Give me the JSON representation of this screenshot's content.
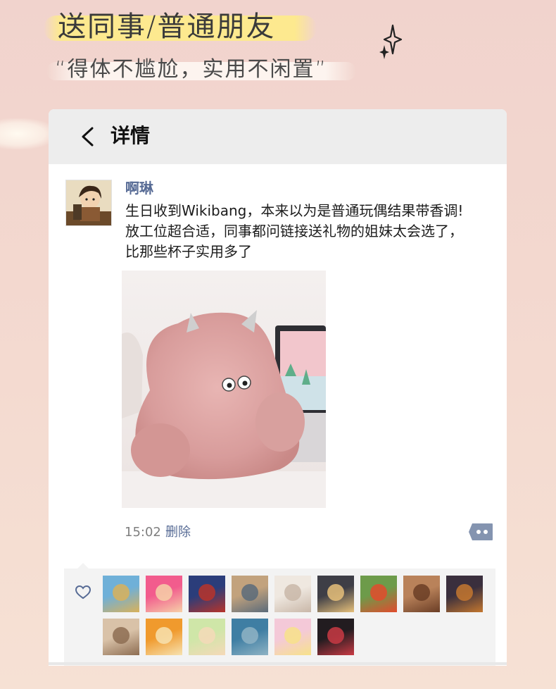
{
  "headline": "送同事/普通朋友",
  "subline": "“得体不尴尬，实用不闲置”",
  "header": {
    "title": "详情"
  },
  "post": {
    "username": "啊琳",
    "lines": [
      "生日收到Wikibang，本来以为是普通玩偶结果带香调!",
      "放工位超合适，同事都问链接送礼物的姐妹太会选了，",
      "比那些杯子实用多了"
    ],
    "time": "15:02",
    "delete_label": "删除"
  },
  "likes": {
    "avatars": [
      {
        "name": "like-avatar-1",
        "colors": [
          "#6fb0d8",
          "#d9b15a"
        ]
      },
      {
        "name": "like-avatar-2",
        "colors": [
          "#f25c8d",
          "#f6d0a8"
        ]
      },
      {
        "name": "like-avatar-3",
        "colors": [
          "#2b3d7a",
          "#b8342a"
        ]
      },
      {
        "name": "like-avatar-4",
        "colors": [
          "#c2a27d",
          "#5b6b7a"
        ]
      },
      {
        "name": "like-avatar-5",
        "colors": [
          "#efe8e0",
          "#c9b7a8"
        ]
      },
      {
        "name": "like-avatar-6",
        "colors": [
          "#3e3e46",
          "#e6c07a"
        ]
      },
      {
        "name": "like-avatar-7",
        "colors": [
          "#6d9b4a",
          "#e24b2d"
        ]
      },
      {
        "name": "like-avatar-8",
        "colors": [
          "#b9825a",
          "#6b3e26"
        ]
      },
      {
        "name": "like-avatar-9",
        "colors": [
          "#3a2f3d",
          "#c4772f"
        ]
      },
      {
        "name": "like-avatar-10",
        "colors": [
          "#d9c2a8",
          "#8d6d52"
        ]
      },
      {
        "name": "like-avatar-11",
        "colors": [
          "#f09a2d",
          "#f7e2b0"
        ]
      },
      {
        "name": "like-avatar-12",
        "colors": [
          "#cfe6a8",
          "#f5d9b8"
        ]
      },
      {
        "name": "like-avatar-13",
        "colors": [
          "#3f7ea3",
          "#8fb3c4"
        ]
      },
      {
        "name": "like-avatar-14",
        "colors": [
          "#f4c9d8",
          "#f7e28a"
        ]
      },
      {
        "name": "like-avatar-15",
        "colors": [
          "#221c20",
          "#c93a44"
        ]
      }
    ]
  },
  "colors": {
    "link": "#576b95",
    "header_bg": "#ededed",
    "likes_bg": "#f3f3f3"
  }
}
